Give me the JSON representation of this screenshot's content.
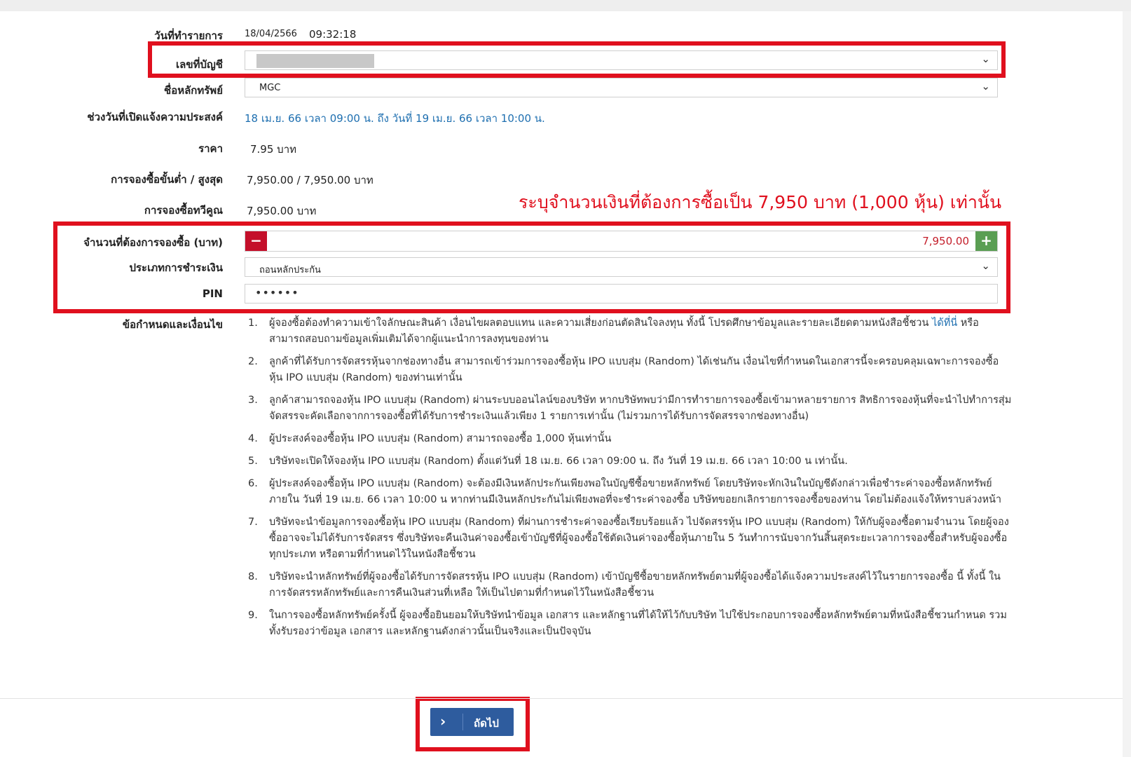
{
  "form": {
    "date_label": "วันที่ทำรายการ",
    "date_value": "18/04/2566",
    "time_value": "09:32:18",
    "account_label": "เลขที่บัญชี",
    "security_label": "ชื่อหลักทรัพย์",
    "security_value": "MGC",
    "period_label": "ช่วงวันที่เปิดแจ้งความประสงค์",
    "period_value": "18 เม.ย. 66 เวลา 09:00 น. ถึง วันที่ 19 เม.ย. 66 เวลา 10:00 น.",
    "price_label": "ราคา",
    "price_value": "7.95  บาท",
    "minmax_label": "การจองซื้อขั้นต่ำ / สูงสุด",
    "minmax_value": "7,950.00 / 7,950.00 บาท",
    "multiple_label": "การจองซื้อทวีคูณ",
    "multiple_value": "7,950.00 บาท",
    "amount_label": "จำนวนที่ต้องการจองซื้อ (บาท)",
    "amount_value": "7,950.00",
    "minus_label": "−",
    "plus_label": "+",
    "payment_label": "ประเภทการชำระเงิน",
    "payment_value": "ถอนหลักประกัน",
    "pin_label": "PIN",
    "pin_value": "••••••",
    "terms_label": "ข้อกำหนดและเงื่อนไข"
  },
  "annotation": {
    "note": "ระบุจำนวนเงินที่ต้องการซื้อเป็น 7,950 บาท (1,000 หุ้น) เท่านั้น"
  },
  "terms": [
    {
      "num": "1.",
      "pre": "ผู้จองซื้อต้องทำความเข้าใจลักษณะสินค้า เงื่อนไขผลตอบแทน และความเสี่ยงก่อนตัดสินใจลงทุน ทั้งนี้ โปรดศึกษาข้อมูลและรายละเอียดตามหนังสือชี้ชวน ",
      "link": "ได้ที่นี่",
      "post": " หรือสามารถสอบถามข้อมูลเพิ่มเติมได้จากผู้แนะนำการลงทุนของท่าน"
    },
    {
      "num": "2.",
      "pre": "ลูกค้าที่ได้รับการจัดสรรหุ้นจากช่องทางอื่น สามารถเข้าร่วมการจองซื้อหุ้น IPO แบบสุ่ม (Random) ได้เช่นกัน เงื่อนไขที่กำหนดในเอกสารนี้จะครอบคลุมเฉพาะการจองซื้อหุ้น IPO แบบสุ่ม (Random) ของท่านเท่านั้น"
    },
    {
      "num": "3.",
      "pre": "ลูกค้าสามารถจองหุ้น IPO แบบสุ่ม (Random) ผ่านระบบออนไลน์ของบริษัท หากบริษัทพบว่ามีการทำรายการจองซื้อเข้ามาหลายรายการ สิทธิการจองหุ้นที่จะนำไปทำการสุ่มจัดสรรจะคัดเลือกจากการจองซื้อที่ได้รับการชำระเงินแล้วเพียง 1 รายการเท่านั้น (ไม่รวมการได้รับการจัดสรรจากช่องทางอื่น)"
    },
    {
      "num": "4.",
      "pre": "ผู้ประสงค์จองซื้อหุ้น IPO แบบสุ่ม (Random) สามารถจองซื้อ 1,000 หุ้นเท่านั้น"
    },
    {
      "num": "5.",
      "pre": "บริษัทจะเปิดให้จองหุ้น IPO แบบสุ่ม (Random) ตั้งแต่วันที่ 18 เม.ย. 66 เวลา 09:00 น. ถึง วันที่ 19 เม.ย. 66 เวลา 10:00 น เท่านั้น."
    },
    {
      "num": "6.",
      "pre": "ผู้ประสงค์จองซื้อหุ้น IPO แบบสุ่ม (Random) จะต้องมีเงินหลักประกันเพียงพอในบัญชีซื้อขายหลักทรัพย์ โดยบริษัทจะหักเงินในบัญชีดังกล่าวเพื่อชำระค่าจองซื้อหลักทรัพย์ ภายใน วันที่ 19 เม.ย. 66 เวลา 10:00 น  หากท่านมีเงินหลักประกันไม่เพียงพอที่จะชำระค่าจองซื้อ บริษัทขอยกเลิกรายการจองซื้อของท่าน โดยไม่ต้องแจ้งให้ทราบล่วงหน้า"
    },
    {
      "num": "7.",
      "pre": "บริษัทจะนำข้อมูลการจองซื้อหุ้น IPO แบบสุ่ม (Random) ที่ผ่านการชำระค่าจองซื้อเรียบร้อยแล้ว ไปจัดสรรหุ้น IPO แบบสุ่ม (Random) ให้กับผู้จองซื้อตามจำนวน โดยผู้จองซื้ออาจจะไม่ได้รับการจัดสรร ซึ่งบริษัทจะคืนเงินค่าจองซื้อเข้าบัญชีที่ผู้จองซื้อใช้ตัดเงินค่าจองซื้อหุ้นภายใน 5 วันทำการนับจากวันสิ้นสุดระยะเวลาการจองซื้อสำหรับผู้จองซื้อทุกประเภท หรือตามที่กำหนดไว้ในหนังสือชี้ชวน"
    },
    {
      "num": "8.",
      "pre": "บริษัทจะนำหลักทรัพย์ที่ผู้จองซื้อได้รับการจัดสรรหุ้น IPO แบบสุ่ม (Random) เข้าบัญชีซื้อขายหลักทรัพย์ตามที่ผู้จองซื้อได้แจ้งความประสงค์ไว้ในรายการจองซื้อ นี้ ทั้งนี้ ในการจัดสรรหลักทรัพย์และการคืนเงินส่วนที่เหลือ ให้เป็นไปตามที่กำหนดไว้ในหนังสือชี้ชวน"
    },
    {
      "num": "9.",
      "pre": "ในการจองซื้อหลักทรัพย์ครั้งนี้ ผู้จองซื้อยินยอมให้บริษัทนำข้อมูล เอกสาร และหลักฐานที่ได้ให้ไว้กับบริษัท ไปใช้ประกอบการจองซื้อหลักทรัพย์ตามที่หนังสือชี้ชวนกำหนด รวมทั้งรับรองว่าข้อมูล เอกสาร และหลักฐานดังกล่าวนั้นเป็นจริงและเป็นปัจจุบัน"
    }
  ],
  "footer": {
    "next_label": "ถัดไป",
    "next_icon": "chevron-right-icon"
  },
  "colors": {
    "highlight": "#e0101e",
    "link": "#1e6fb0",
    "primary_button": "#2e5c9e",
    "minus_button": "#c40f2a",
    "plus_button": "#5a9e53"
  }
}
